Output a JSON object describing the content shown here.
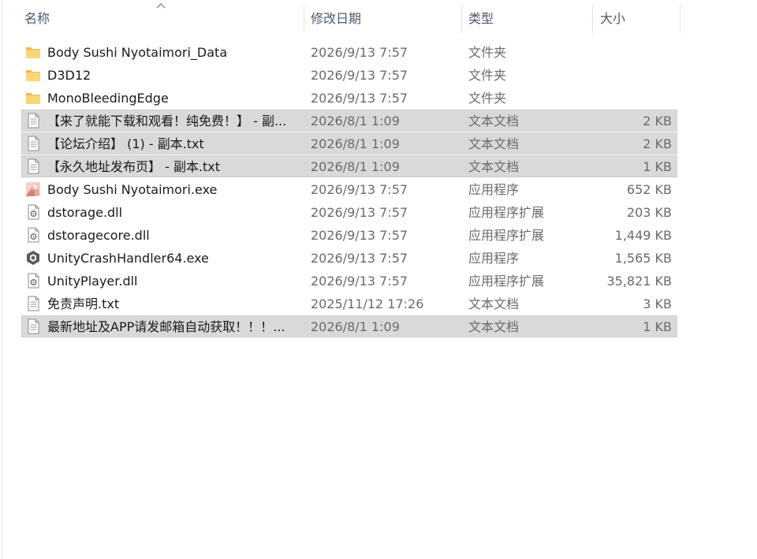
{
  "columns": {
    "name": "名称",
    "date": "修改日期",
    "type": "类型",
    "size": "大小"
  },
  "files": [
    {
      "name": "Body Sushi Nyotaimori_Data",
      "date": "2026/9/13 7:57",
      "type": "文件夹",
      "size": "",
      "icon": "folder-icon",
      "selected": false
    },
    {
      "name": "D3D12",
      "date": "2026/9/13 7:57",
      "type": "文件夹",
      "size": "",
      "icon": "folder-icon",
      "selected": false
    },
    {
      "name": "MonoBleedingEdge",
      "date": "2026/9/13 7:57",
      "type": "文件夹",
      "size": "",
      "icon": "folder-icon",
      "selected": false
    },
    {
      "name": "【来了就能下载和观看！纯免费！】 - 副...",
      "date": "2026/8/1 1:09",
      "type": "文本文档",
      "size": "2 KB",
      "icon": "text-file-icon",
      "selected": true
    },
    {
      "name": "【论坛介绍】 (1) - 副本.txt",
      "date": "2026/8/1 1:09",
      "type": "文本文档",
      "size": "2 KB",
      "icon": "text-file-icon",
      "selected": true
    },
    {
      "name": "【永久地址发布页】 - 副本.txt",
      "date": "2026/8/1 1:09",
      "type": "文本文档",
      "size": "1 KB",
      "icon": "text-file-icon",
      "selected": true
    },
    {
      "name": "Body Sushi Nyotaimori.exe",
      "date": "2026/9/13 7:57",
      "type": "应用程序",
      "size": "652 KB",
      "icon": "app-exe-icon",
      "selected": false
    },
    {
      "name": "dstorage.dll",
      "date": "2026/9/13 7:57",
      "type": "应用程序扩展",
      "size": "203 KB",
      "icon": "dll-file-icon",
      "selected": false
    },
    {
      "name": "dstoragecore.dll",
      "date": "2026/9/13 7:57",
      "type": "应用程序扩展",
      "size": "1,449 KB",
      "icon": "dll-file-icon",
      "selected": false
    },
    {
      "name": "UnityCrashHandler64.exe",
      "date": "2026/9/13 7:57",
      "type": "应用程序",
      "size": "1,565 KB",
      "icon": "unity-icon",
      "selected": false
    },
    {
      "name": "UnityPlayer.dll",
      "date": "2026/9/13 7:57",
      "type": "应用程序扩展",
      "size": "35,821 KB",
      "icon": "dll-file-icon",
      "selected": false
    },
    {
      "name": "免责声明.txt",
      "date": "2025/11/12 17:26",
      "type": "文本文档",
      "size": "3 KB",
      "icon": "text-file-icon",
      "selected": false
    },
    {
      "name": "最新地址及APP请发邮箱自动获取！！！...",
      "date": "2026/8/1 1:09",
      "type": "文本文档",
      "size": "1 KB",
      "icon": "text-file-icon",
      "selected": true
    }
  ],
  "colors": {
    "selection": "#d9d9d9",
    "folder": "#f8d775",
    "header_text": "#4a5a6a"
  }
}
